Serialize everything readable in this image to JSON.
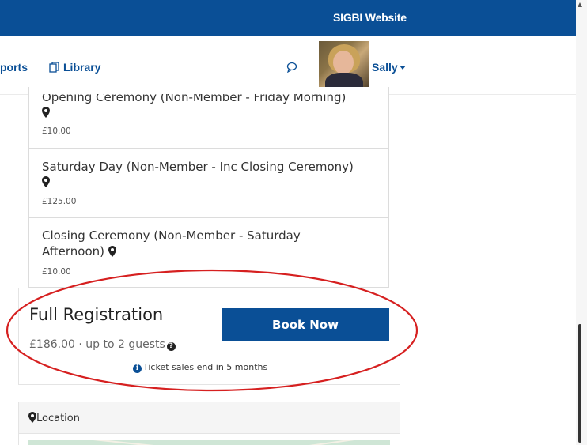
{
  "header": {
    "site_link": "SIGBI Website"
  },
  "nav": {
    "reports_label": "ports",
    "library_label": "Library",
    "user_name": "Sally"
  },
  "tickets": [
    {
      "title": "Opening Ceremony (Non-Member - Friday Morning)",
      "price": "£10.00"
    },
    {
      "title": "Saturday Day (Non-Member - Inc Closing Ceremony)",
      "price": "£125.00"
    },
    {
      "title": "Closing Ceremony (Non-Member - Saturday Afternoon)",
      "price": "£10.00"
    }
  ],
  "registration": {
    "title": "Full Registration",
    "price_text": "£186.00 · up to 2 guests",
    "book_label": "Book Now",
    "sales_note": "Ticket sales end in 5 months"
  },
  "location": {
    "label": "Location"
  },
  "colors": {
    "brand": "#0a4f96",
    "annotation": "#d62020"
  },
  "icons": {
    "library": "library-icon",
    "chat": "chat-bubble-icon",
    "pin": "map-pin-icon",
    "question": "question-circle-icon",
    "info": "info-circle-icon"
  }
}
